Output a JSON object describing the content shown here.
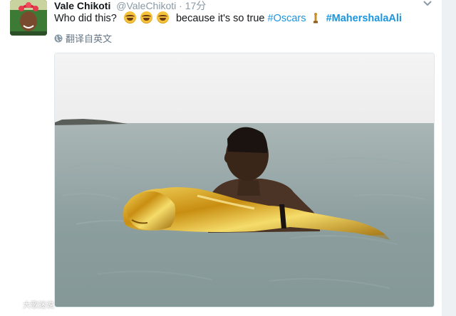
{
  "tweet": {
    "author_name": "Vale Chikoti",
    "author_handle": "@ValeChikoti",
    "timestamp": "· 17分",
    "text_before": "Who did this?",
    "text_middle": "because it's so true",
    "hashtag_1": "#Oscars",
    "hashtag_2": "#MahershalaAli",
    "emoji": "tears-of-joy",
    "emoji_count": 3,
    "translate_label": "翻译自英文"
  },
  "media": {
    "icon": "image",
    "description_icons": [
      "man-in-sea-icon",
      "golden-oscar-statue-icon"
    ]
  },
  "watermark": {
    "text": "大歌迷说"
  },
  "colors": {
    "link": "#1b95e0",
    "text": "#14171a",
    "muted": "#8899a6",
    "sea": "#8fa1a2",
    "sky": "#f3f3f3",
    "gold": "#d9a21a"
  }
}
